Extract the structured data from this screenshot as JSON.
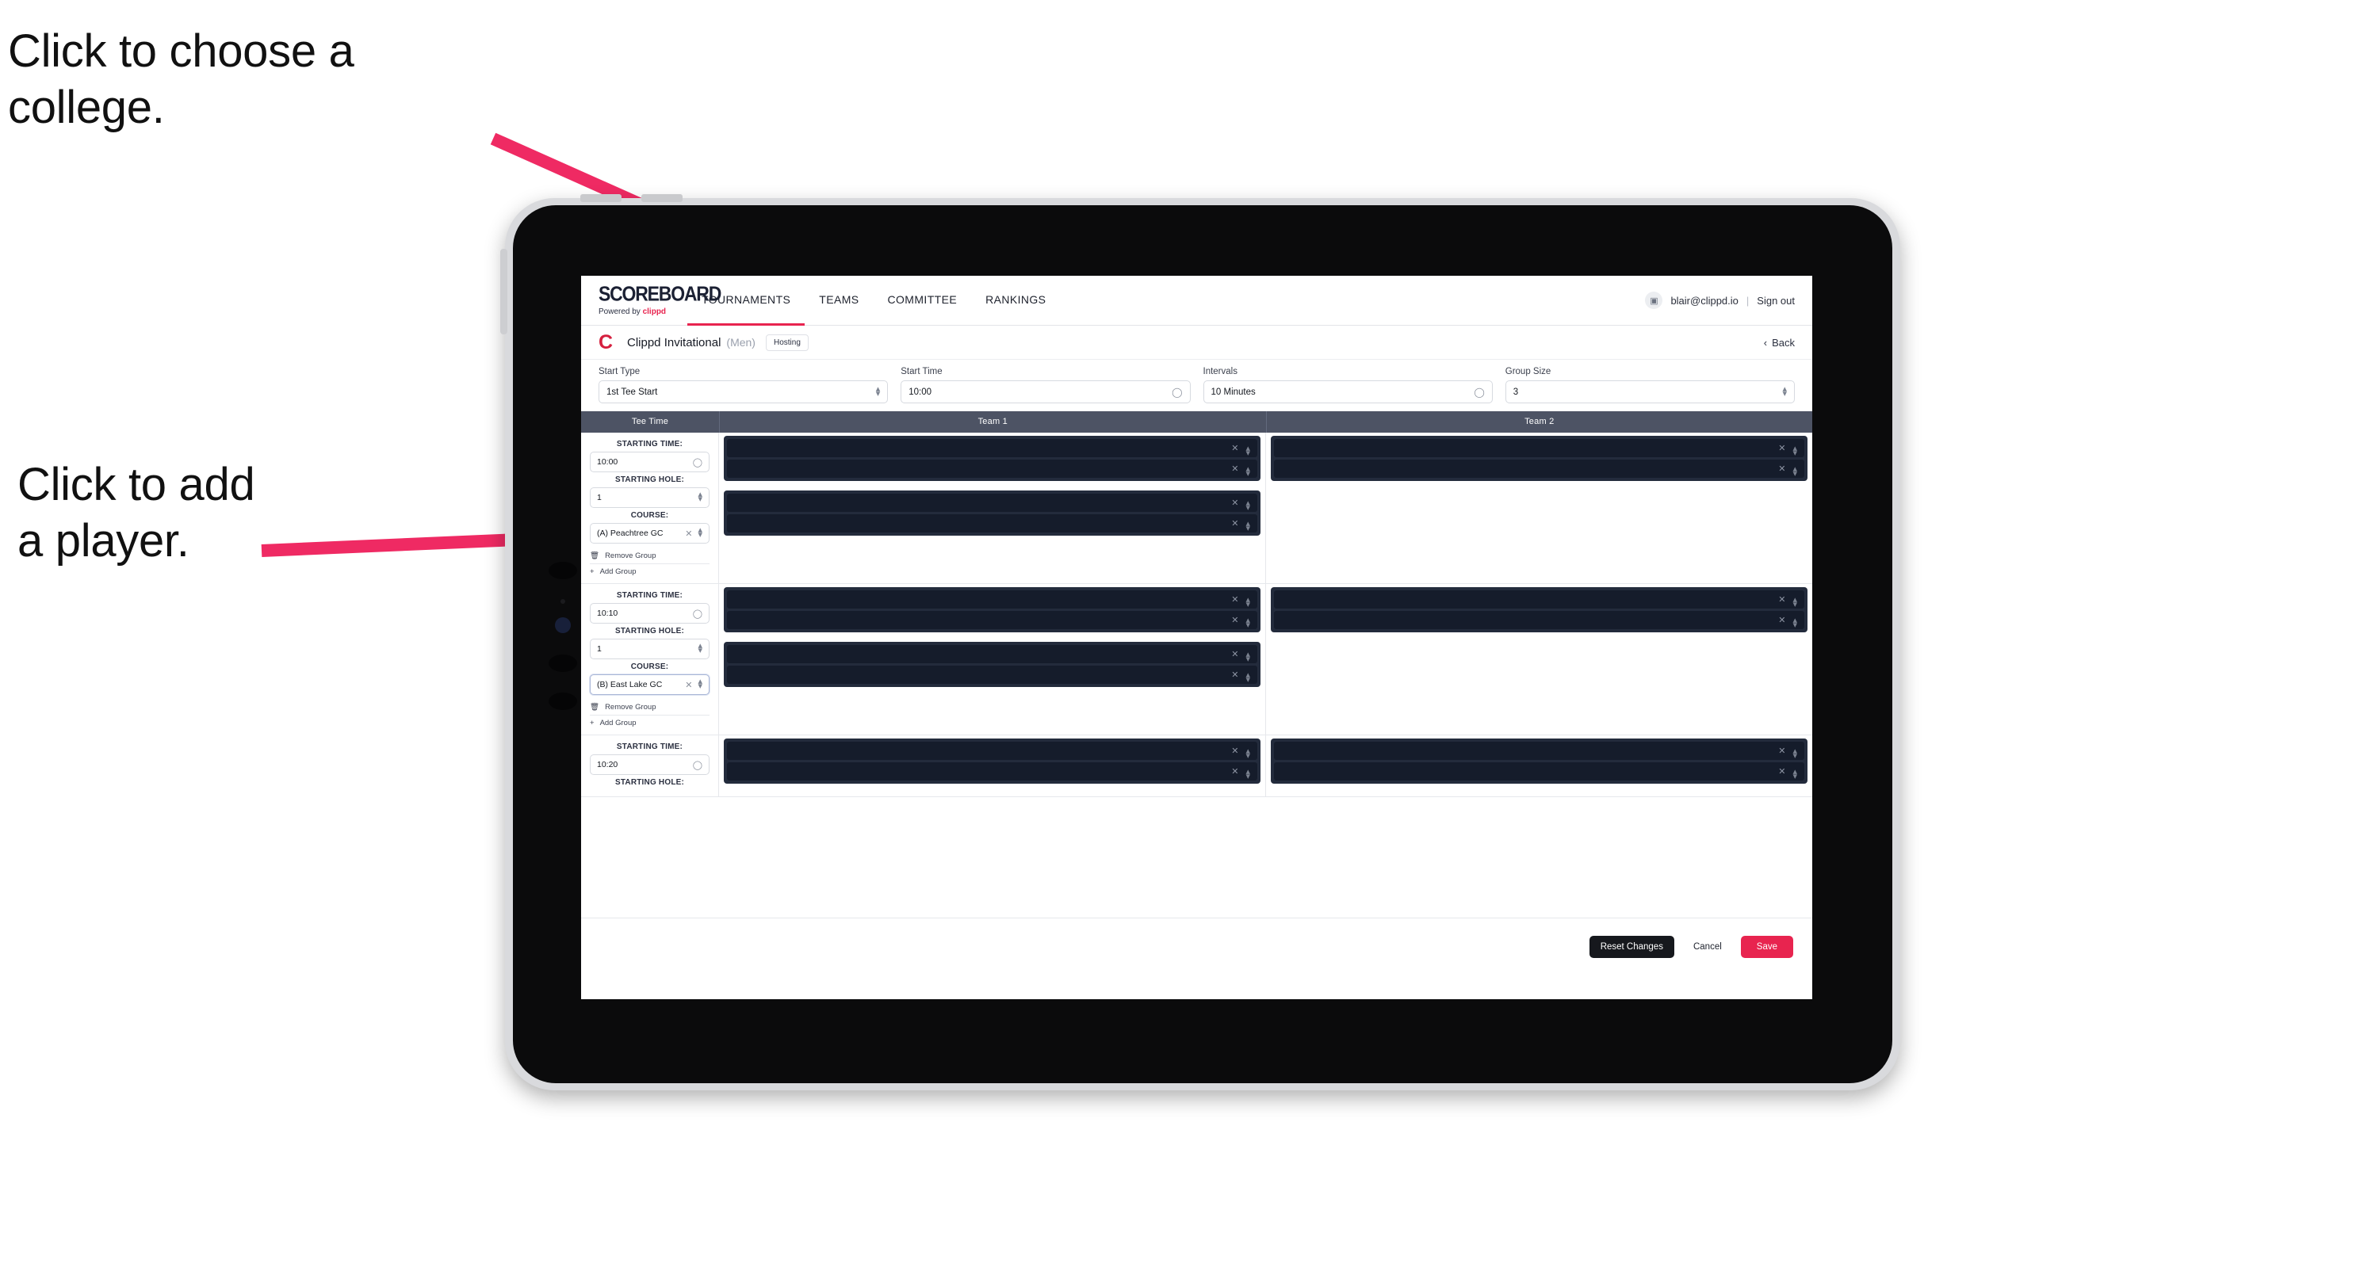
{
  "annotations": {
    "choose_college": "Click to choose a\ncollege.",
    "add_player": "Click to add\na player."
  },
  "colors": {
    "accent_pink": "#e8244f",
    "annotation_arrow": "#ef2a63",
    "table_header": "#4d5364",
    "player_group_bg": "#232b3c",
    "player_slot_bg": "#151c2b"
  },
  "navbar": {
    "brand_title": "SCOREBOARD",
    "brand_sub_prefix": "Powered by ",
    "brand_sub_name": "clippd",
    "links": [
      {
        "label": "TOURNAMENTS",
        "active": true
      },
      {
        "label": "TEAMS",
        "active": false
      },
      {
        "label": "COMMITTEE",
        "active": false
      },
      {
        "label": "RANKINGS",
        "active": false
      }
    ],
    "avatar_icon": "user-image-icon",
    "account_email": "blair@clippd.io",
    "separator": "|",
    "sign_out_label": "Sign out"
  },
  "tournament_header": {
    "logo_letter": "C",
    "name": "Clippd Invitational",
    "gender": "(Men)",
    "role_badge": "Hosting",
    "back_chevron": "‹",
    "back_label": "Back"
  },
  "controls": [
    {
      "label": "Start Type",
      "value": "1st Tee Start",
      "icon": "stepper-icon"
    },
    {
      "label": "Start Time",
      "value": "10:00",
      "icon": "clock-icon"
    },
    {
      "label": "Intervals",
      "value": "10 Minutes",
      "icon": "clock-icon"
    },
    {
      "label": "Group Size",
      "value": "3",
      "icon": "stepper-icon"
    }
  ],
  "table": {
    "headers": {
      "tee_time": "Tee Time",
      "team1": "Team 1",
      "team2": "Team 2"
    },
    "field_labels": {
      "starting_time": "STARTING TIME:",
      "starting_hole": "STARTING HOLE:",
      "course": "COURSE:"
    },
    "group_actions": {
      "remove": "Remove Group",
      "add": "Add Group",
      "remove_icon": "trash-icon",
      "add_icon": "plus-icon"
    },
    "slot_icons": {
      "clear": "close-icon",
      "stepper": "stepper-icon"
    },
    "rows": [
      {
        "starting_time": "10:00",
        "starting_hole": "1",
        "course": "(A) Peachtree GC",
        "course_focused": false,
        "team1_groups": [
          {
            "slots": [
              "",
              ""
            ]
          },
          {
            "slots": [
              "",
              ""
            ]
          }
        ],
        "team2_groups": [
          {
            "slots": [
              "",
              ""
            ]
          }
        ]
      },
      {
        "starting_time": "10:10",
        "starting_hole": "1",
        "course": "(B) East Lake GC",
        "course_focused": true,
        "team1_groups": [
          {
            "slots": [
              "",
              ""
            ]
          },
          {
            "slots": [
              "",
              ""
            ]
          }
        ],
        "team2_groups": [
          {
            "slots": [
              "",
              ""
            ]
          }
        ]
      },
      {
        "starting_time": "10:20",
        "starting_hole": "",
        "course": "",
        "course_focused": false,
        "team1_groups": [
          {
            "slots": [
              "",
              ""
            ]
          }
        ],
        "team2_groups": [
          {
            "slots": [
              "",
              ""
            ]
          }
        ]
      }
    ]
  },
  "footer": {
    "reset_label": "Reset Changes",
    "cancel_label": "Cancel",
    "save_label": "Save"
  }
}
